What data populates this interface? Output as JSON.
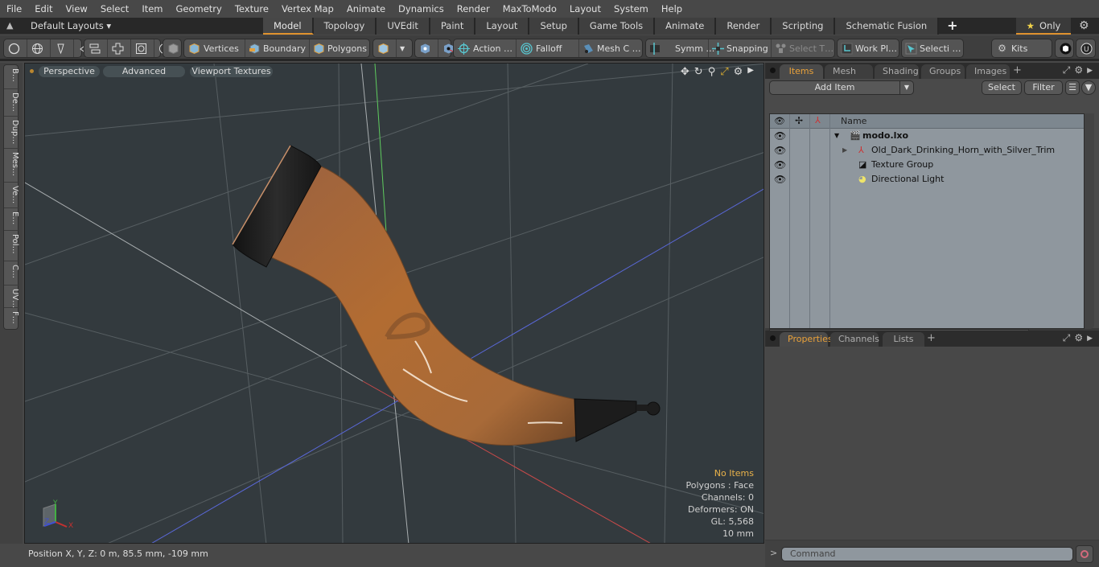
{
  "menu": [
    "File",
    "Edit",
    "View",
    "Select",
    "Item",
    "Geometry",
    "Texture",
    "Vertex Map",
    "Animate",
    "Dynamics",
    "Render",
    "MaxToModo",
    "Layout",
    "System",
    "Help"
  ],
  "layoutbar": {
    "layouts_label": "Default Layouts ▾",
    "tabs": [
      "Model",
      "Topology",
      "UVEdit",
      "Paint",
      "Layout",
      "Setup",
      "Game Tools",
      "Animate",
      "Render",
      "Scripting",
      "Schematic Fusion"
    ],
    "active_tab": "Model",
    "only_label": "Only"
  },
  "toolbar": {
    "vertices": "Vertices",
    "boundary": "Boundary",
    "polygons": "Polygons",
    "action": "Action  …",
    "falloff": "Falloff",
    "mesh": "Mesh C …",
    "symm": "Symm …",
    "snapping": "Snapping",
    "select_t": "Select T…",
    "workplane": "Work Pl…",
    "selecti": "Selecti …",
    "kits": "Kits"
  },
  "left_tabs": [
    "B…",
    "De…",
    "Dup…",
    "Mes…",
    "Ve…",
    "E…",
    "Pol…",
    "C…",
    "UV…",
    "F…"
  ],
  "viewport": {
    "buttons": [
      "Perspective",
      "Advanced",
      "Viewport Textures"
    ],
    "hud": {
      "selection": "No Items",
      "polygons": "Polygons : Face",
      "channels": "Channels: 0",
      "deformers": "Deformers: ON",
      "gl": "GL: 5,568",
      "scale": "10 mm"
    },
    "axis_labels": {
      "x": "X",
      "y": "Y",
      "z": "Z"
    },
    "accent_colors": {
      "x_axis": "#c84a4a",
      "y_axis": "#5ecb5e",
      "z_axis": "#5a68d8",
      "horn": "#b06a33",
      "trim": "#1e1e1e"
    }
  },
  "status": {
    "position": "Position X, Y, Z:   0 m, 85.5 mm, -109 mm"
  },
  "items_panel": {
    "tabs": [
      "Items",
      "Mesh Ops",
      "Shading",
      "Groups",
      "Images"
    ],
    "active_tab": "Items",
    "add_item": "Add Item",
    "select": "Select",
    "filter": "Filter",
    "column_name": "Name",
    "rows": [
      {
        "label": "modo.lxo",
        "icon": "scene-icon"
      },
      {
        "label": "Old_Dark_Drinking_Horn_with_Silver_Trim",
        "icon": "mesh-locator-icon"
      },
      {
        "label": "Texture Group",
        "icon": "texture-group-icon"
      },
      {
        "label": "Directional Light",
        "icon": "light-icon"
      }
    ]
  },
  "properties_panel": {
    "tabs": [
      "Properties",
      "Channels",
      "Lists"
    ],
    "active_tab": "Properties"
  },
  "command": {
    "placeholder": "Command",
    "prompt": ">"
  }
}
